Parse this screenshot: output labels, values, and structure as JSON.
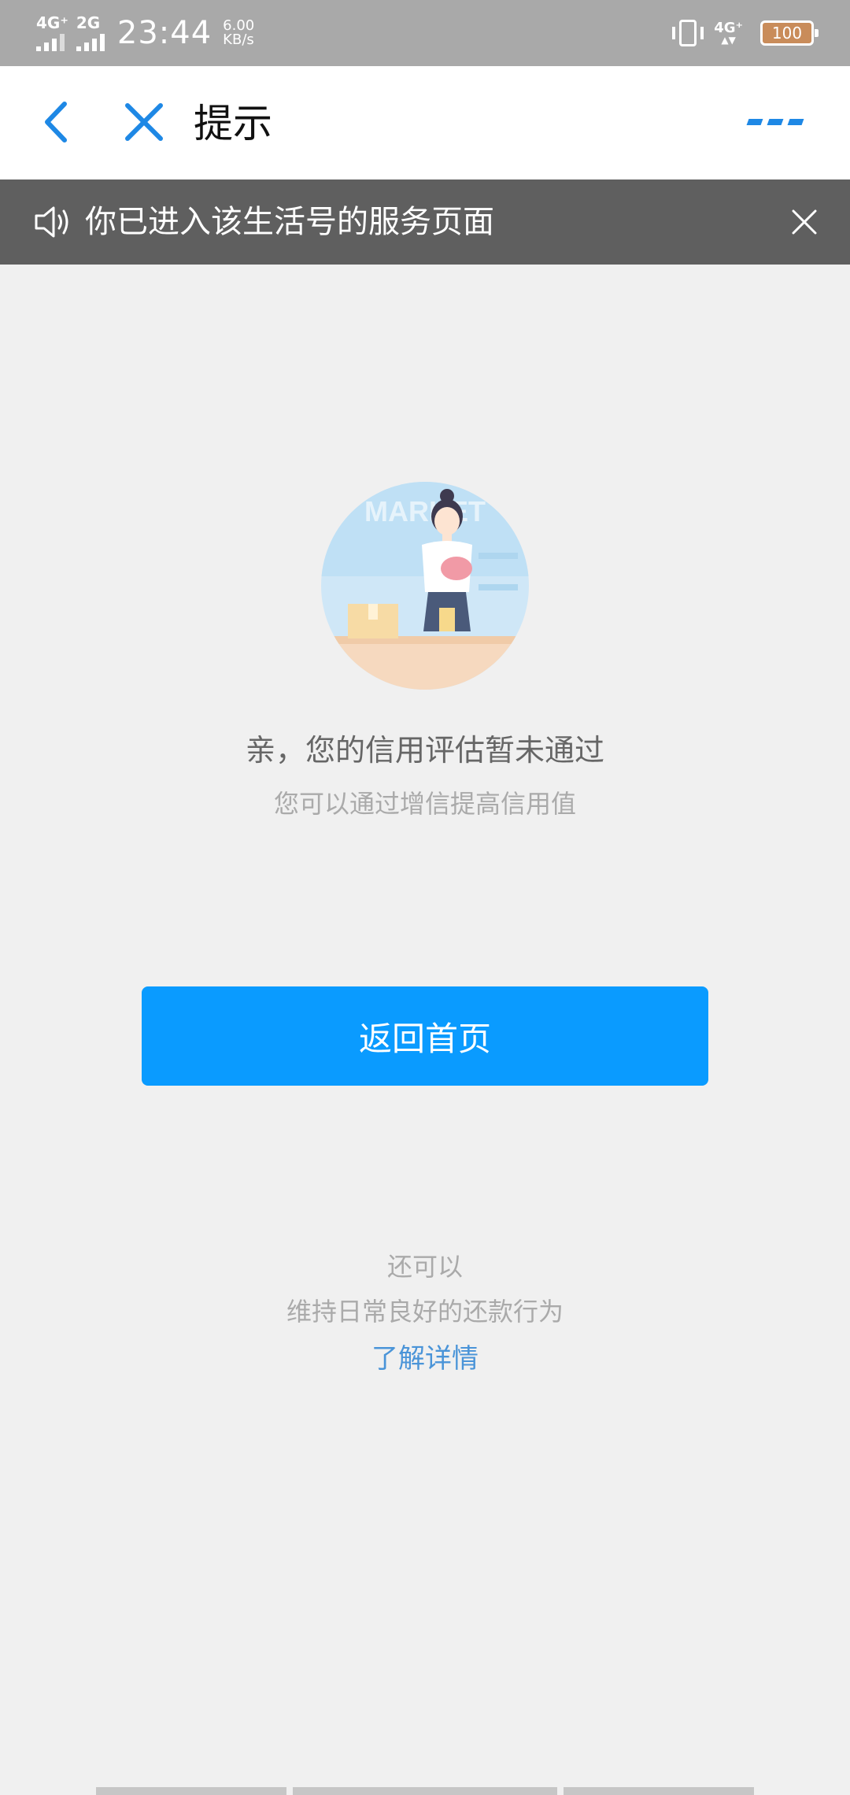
{
  "status_bar": {
    "network1": "4G⁺",
    "network2": "2G",
    "time": "23:44",
    "speed_value": "6.00",
    "speed_unit": "KB/s",
    "network3": "4G⁺",
    "battery": "100"
  },
  "nav": {
    "title": "提示",
    "back_icon": "chevron-left-icon",
    "close_icon": "close-icon",
    "more_icon": "more-icon",
    "accent": "#1e88e5"
  },
  "notice": {
    "text": "你已进入该生活号的服务页面",
    "icon": "speaker-icon",
    "close_icon": "close-icon"
  },
  "content": {
    "illustration_sign": "MARKET",
    "title": "亲，您的信用评估暂未通过",
    "subtitle": "您可以通过增信提高信用值",
    "button_label": "返回首页",
    "button_color": "#0a9bff",
    "extra_line1": "还可以",
    "extra_line2": "维持日常良好的还款行为",
    "link_text": "了解详情",
    "link_color": "#4a94d8"
  }
}
